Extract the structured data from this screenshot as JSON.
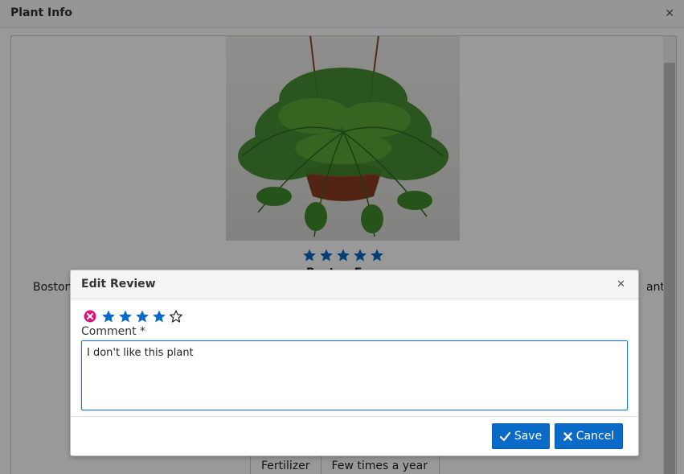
{
  "outer_dialog": {
    "title": "Plant Info",
    "close_icon": "close-icon"
  },
  "plant": {
    "name": "Boston Fern",
    "rating": 5,
    "description_left": "Boston",
    "description_right": "ant",
    "care_table": {
      "rows": [
        [
          "Fertilizer",
          "Few times a year"
        ]
      ]
    }
  },
  "modal": {
    "title": "Edit Review",
    "rating": 4,
    "max_rating": 5,
    "comment_label": "Comment *",
    "comment_value": "I don't like this plant",
    "save_label": "Save",
    "cancel_label": "Cancel",
    "save_icon": "check-icon",
    "cancel_icon": "x-icon"
  },
  "colors": {
    "accent": "#0a6ac7",
    "clear_rating": "#e2127b",
    "star_filled": "#0a6ac7"
  }
}
